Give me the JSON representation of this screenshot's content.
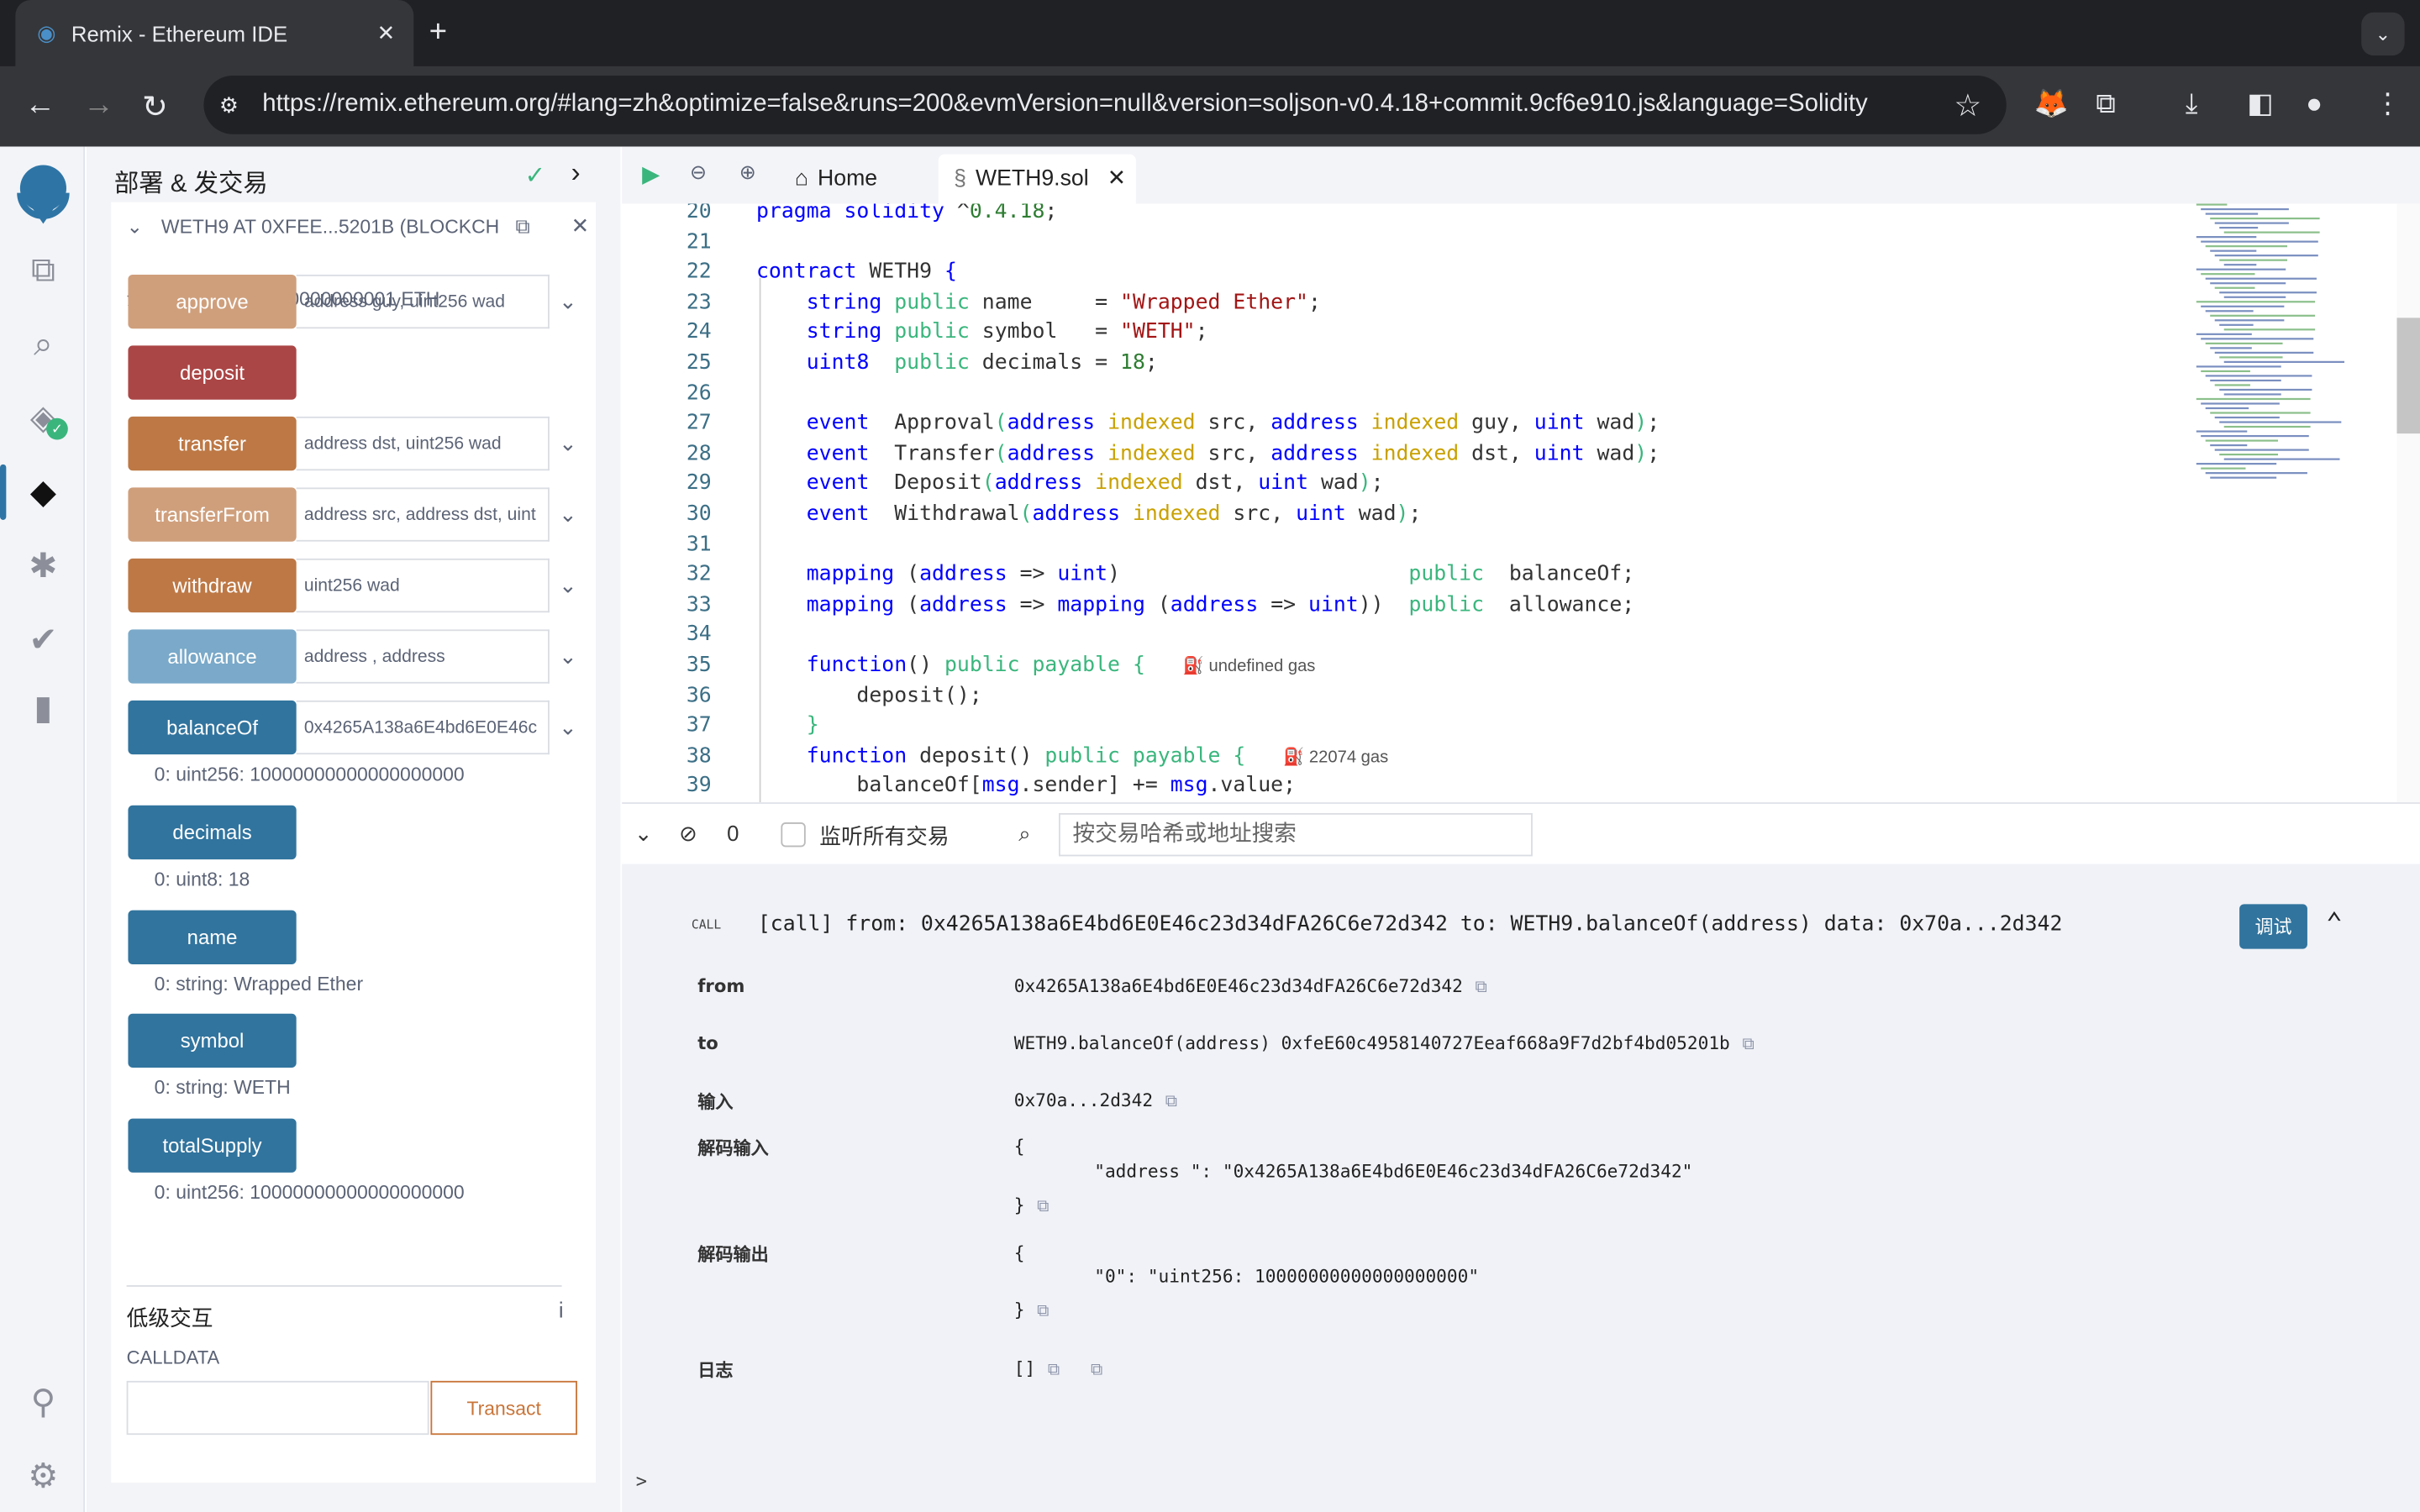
{
  "browser": {
    "tab_title": "Remix - Ethereum IDE",
    "url": "https://remix.ethereum.org/#lang=zh&optimize=false&runs=200&evmVersion=null&version=soljson-v0.4.18+commit.9cf6e910.js&language=Solidity"
  },
  "panel": {
    "title": "部署 & 发交易",
    "instance": "WETH9 AT 0XFEE...5201B (BLOCKCH",
    "balance": "余额: 10.000000000000000001 ETH",
    "functions": [
      {
        "label": "approve",
        "input": "address guy, uint256 wad",
        "color": "#cf9f7c"
      },
      {
        "label": "deposit",
        "input": "",
        "color": "#ab4646"
      },
      {
        "label": "transfer",
        "input": "address dst, uint256 wad",
        "color": "#bd7845"
      },
      {
        "label": "transferFrom",
        "input": "address src, address dst, uint",
        "color": "#cf9f7c"
      },
      {
        "label": "withdraw",
        "input": "uint256 wad",
        "color": "#bd7845"
      },
      {
        "label": "allowance",
        "input": "address , address",
        "color": "#7aa9c9"
      },
      {
        "label": "balanceOf",
        "input": "0x4265A138a6E4bd6E0E46c",
        "color": "#31749e"
      },
      {
        "label": "decimals",
        "color": "#31749e"
      },
      {
        "label": "name",
        "color": "#31749e"
      },
      {
        "label": "symbol",
        "color": "#31749e"
      },
      {
        "label": "totalSupply",
        "color": "#31749e"
      }
    ],
    "results": {
      "balanceOf": "0: uint256: 10000000000000000000",
      "decimals": "0: uint8: 18",
      "name": "0: string: Wrapped Ether",
      "symbol": "0: string: WETH",
      "totalSupply": "0: uint256: 10000000000000000000"
    },
    "low_level": {
      "title": "低级交互",
      "calldata_label": "CALLDATA",
      "transact": "Transact"
    }
  },
  "editor": {
    "tabs": {
      "home": "Home",
      "file": "WETH9.sol"
    },
    "lines": [
      {
        "n": "20",
        "html": "<span class='k'>pragma solidity</span> ^<span class='n'>0.4.18</span>;"
      },
      {
        "n": "21",
        "html": ""
      },
      {
        "n": "22",
        "html": "<span class='k'>contract</span> WETH9 <span class='k'>{</span>"
      },
      {
        "n": "23",
        "html": "    <span class='k'>string</span> <span class='p'>public</span> name     = <span class='s'>\"Wrapped Ether\"</span>;"
      },
      {
        "n": "24",
        "html": "    <span class='k'>string</span> <span class='p'>public</span> symbol   = <span class='s'>\"WETH\"</span>;"
      },
      {
        "n": "25",
        "html": "    <span class='k'>uint8</span>  <span class='p'>public</span> decimals = <span class='n'>18</span>;"
      },
      {
        "n": "26",
        "html": ""
      },
      {
        "n": "27",
        "html": "    <span class='k'>event</span>  Approval<span class='p'>(</span><span class='k'>address</span> <span class='i'>indexed</span> src, <span class='k'>address</span> <span class='i'>indexed</span> guy, <span class='k'>uint</span> wad<span class='p'>)</span>;"
      },
      {
        "n": "28",
        "html": "    <span class='k'>event</span>  Transfer<span class='p'>(</span><span class='k'>address</span> <span class='i'>indexed</span> src, <span class='k'>address</span> <span class='i'>indexed</span> dst, <span class='k'>uint</span> wad<span class='p'>)</span>;"
      },
      {
        "n": "29",
        "html": "    <span class='k'>event</span>  Deposit<span class='p'>(</span><span class='k'>address</span> <span class='i'>indexed</span> dst, <span class='k'>uint</span> wad<span class='p'>)</span>;"
      },
      {
        "n": "30",
        "html": "    <span class='k'>event</span>  Withdrawal<span class='p'>(</span><span class='k'>address</span> <span class='i'>indexed</span> src, <span class='k'>uint</span> wad<span class='p'>)</span>;"
      },
      {
        "n": "31",
        "html": ""
      },
      {
        "n": "32",
        "html": "    <span class='k'>mapping</span> (<span class='k'>address</span> => <span class='k'>uint</span>)                       <span class='p'>public</span>  balanceOf;"
      },
      {
        "n": "33",
        "html": "    <span class='k'>mapping</span> (<span class='k'>address</span> => <span class='k'>mapping</span> (<span class='k'>address</span> => <span class='k'>uint</span>))  <span class='p'>public</span>  allowance;"
      },
      {
        "n": "34",
        "html": ""
      },
      {
        "n": "35",
        "html": "    <span class='k'>function</span>() <span class='p'>public payable</span> <span class='p'>{</span>   <span class='g'>⛽ undefined gas</span>"
      },
      {
        "n": "36",
        "html": "        deposit();"
      },
      {
        "n": "37",
        "html": "    <span class='p'>}</span>"
      },
      {
        "n": "38",
        "html": "    <span class='k'>function</span> deposit() <span class='p'>public payable</span> <span class='p'>{</span>   <span class='g'>⛽ 22074 gas</span>"
      },
      {
        "n": "39",
        "html": "        balanceOf[<span class='k'>msg</span>.sender] += <span class='k'>msg</span>.value;"
      }
    ]
  },
  "terminal": {
    "count": "0",
    "listen_label": "监听所有交易",
    "search_placeholder": "按交易哈希或地址搜索",
    "call_tag": "CALL",
    "call_line": "[call] from: 0x4265A138a6E4bd6E0E46c23d34dFA26C6e72d342 to: WETH9.balanceOf(address) data: 0x70a...2d342",
    "debug": "调试",
    "rows": {
      "from_label": "from",
      "from": "0x4265A138a6E4bd6E0E46c23d34dFA26C6e72d342",
      "to_label": "to",
      "to": "WETH9.balanceOf(address) 0xfeE60c4958140727Eeaf668a9F7d2bf4bd05201b",
      "input_label": "输入",
      "input": "0x70a...2d342",
      "dec_in_label": "解码输入",
      "dec_in_open": "{",
      "dec_in_body": "\"address \": \"0x4265A138a6E4bd6E0E46c23d34dFA26C6e72d342\"",
      "dec_in_close": "}",
      "dec_out_label": "解码输出",
      "dec_out_open": "{",
      "dec_out_body": "\"0\": \"uint256: 10000000000000000000\"",
      "dec_out_close": "}",
      "logs_label": "日志",
      "logs": "[]"
    },
    "prompt": ">"
  }
}
